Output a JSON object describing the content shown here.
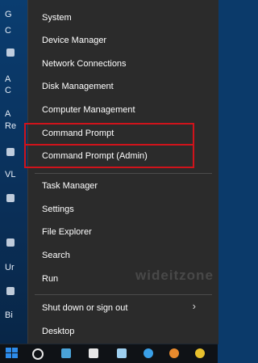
{
  "desktop": {
    "labels": [
      "G",
      "C",
      "A",
      "C",
      "A",
      "Re",
      "VL",
      "Ur",
      "Bi"
    ]
  },
  "menu": {
    "items": [
      {
        "label": "System"
      },
      {
        "label": "Device Manager"
      },
      {
        "label": "Network Connections"
      },
      {
        "label": "Disk Management"
      },
      {
        "label": "Computer Management"
      },
      {
        "label": "Command Prompt"
      },
      {
        "label": "Command Prompt (Admin)"
      },
      {
        "label": "Task Manager"
      },
      {
        "label": "Settings"
      },
      {
        "label": "File Explorer"
      },
      {
        "label": "Search"
      },
      {
        "label": "Run"
      },
      {
        "label": "Shut down or sign out"
      },
      {
        "label": "Desktop"
      }
    ],
    "submenu_glyph": "›"
  },
  "watermark": "wideitzone",
  "colors": {
    "menu_bg": "#2b2b2b",
    "highlight": "#d0131b",
    "accent": "#2d8ceb"
  },
  "taskbar": {
    "icons": [
      "start-icon",
      "cortana-icon",
      "app-icon",
      "mail-icon",
      "store-icon",
      "edge-icon",
      "firefox-icon",
      "chrome-icon"
    ]
  }
}
